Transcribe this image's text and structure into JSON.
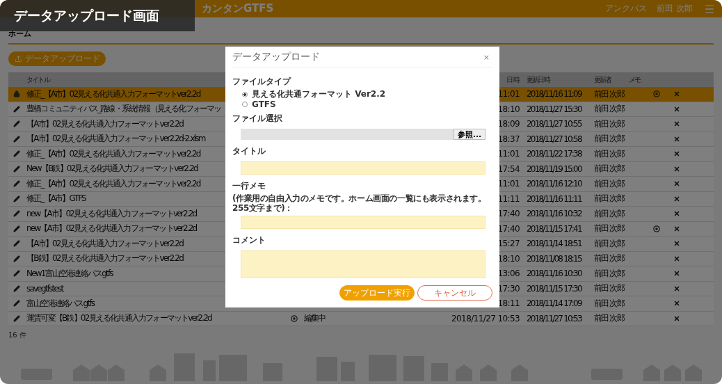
{
  "caption": "データアップロード画面",
  "app": {
    "title": "カンタンGTFS",
    "company": "アンクバス",
    "user": "前田 次郎",
    "breadcrumb": "ホーム",
    "upload_button": "データアップロード",
    "table": {
      "columns": {
        "title": "タイトル",
        "created": "日時",
        "updated": "更新日時",
        "updater": "更新者",
        "memo": "メモ"
      },
      "rows": [
        {
          "kind": "lock",
          "title": "修正_【A市】02見える化共通入力フォーマットver2.2d",
          "created": "11:01",
          "updated": "2018/11/16 11:09",
          "updater": "前田 次郎",
          "marked": true,
          "selected": true
        },
        {
          "kind": "edit",
          "title": "豊橋コミュニティバス_路線・系統情報（見える化フォーマッ",
          "created": "18:10",
          "updated": "2018/11/27 15:30",
          "updater": "前田 次郎",
          "marked": false,
          "selected": false
        },
        {
          "kind": "edit",
          "title": "【A市】02見える化共通入力フォーマットver2.2d",
          "created": "18:09",
          "updated": "2018/11/27 10:55",
          "updater": "前田 次郎",
          "marked": false,
          "selected": false
        },
        {
          "kind": "edit",
          "title": "【A市】02見える化共通入力フォーマットver2.2d-2.xlsm",
          "created": "18:37",
          "updated": "2018/11/27 10:58",
          "updater": "前田 次郎",
          "marked": false,
          "selected": false
        },
        {
          "kind": "edit",
          "title": "修正_【A市】02見える化共通入力フォーマットver2.2d",
          "created": "11:01",
          "updated": "2018/11/22 17:38",
          "updater": "前田 次郎",
          "marked": false,
          "selected": false
        },
        {
          "kind": "edit",
          "title": "New【B鉄】02見える化共通入力フォーマットver2.2d",
          "created": "17:54",
          "updated": "2018/11/19 15:00",
          "updater": "前田 次郎",
          "marked": false,
          "selected": false
        },
        {
          "kind": "edit",
          "title": "修正_【A市】02見える化共通入力フォーマットver2.2d",
          "created": "11:01",
          "updated": "2018/11/16 12:10",
          "updater": "前田 次郎",
          "marked": false,
          "selected": false
        },
        {
          "kind": "edit",
          "title": "修正_【A市】GTFS",
          "created": "11:11",
          "updated": "2018/11/16 11:11",
          "updater": "前田 次郎",
          "marked": false,
          "selected": false
        },
        {
          "kind": "edit",
          "title": "new【A市】02見える化共通入力フォーマットver2.2d",
          "created": "17:40",
          "updated": "2018/11/16 10:32",
          "updater": "前田 次郎",
          "marked": false,
          "selected": false
        },
        {
          "kind": "edit",
          "title": "new【A市】02見える化共通入力フォーマットver2.2d",
          "created": "17:40",
          "updated": "2018/11/15 17:41",
          "updater": "前田 次郎",
          "marked": true,
          "selected": false
        },
        {
          "kind": "edit",
          "title": "【A市】02見える化共通入力フォーマットver2.2d",
          "created": "15:27",
          "updated": "2018/11/14 18:51",
          "updater": "前田 次郎",
          "marked": false,
          "selected": false
        },
        {
          "kind": "edit",
          "title": "【B鉄】02見える化共通入力フォーマットver2.2d",
          "created": "18:10",
          "updated": "2018/11/08 18:15",
          "updater": "前田 次郎",
          "marked": false,
          "selected": false
        },
        {
          "kind": "edit",
          "title": "New1富山空港連絡バスgtfs",
          "created": "13:06",
          "updated": "2018/11/16 10:30",
          "updater": "前田 次郎",
          "marked": false,
          "selected": false
        },
        {
          "kind": "edit",
          "title": "savegtfstest",
          "created": "17:30",
          "updated": "2018/11/15 17:30",
          "updater": "前田 次郎",
          "marked": false,
          "selected": false
        },
        {
          "kind": "edit",
          "title": "富山空港連絡バスgtfs",
          "created": "18:11",
          "updated": "2018/11/14 17:09",
          "updater": "前田 次郎",
          "marked": false,
          "selected": false
        },
        {
          "kind": "edit",
          "title": "運賃可変【B鉄】02見える化共通入力フォーマットver2.2d",
          "status": "編集中",
          "created": "2018/11/27 10:53",
          "updated": "2018/11/27 10:53",
          "updater": "前田 次郎",
          "marked": false,
          "selected": false
        }
      ]
    },
    "count": "16 件"
  },
  "dialog": {
    "title": "データアップロード",
    "close": "×",
    "file_type": {
      "label": "ファイルタイプ",
      "options": [
        {
          "label": "見える化共通フォーマット Ver2.2",
          "selected": true
        },
        {
          "label": "GTFS",
          "selected": false
        }
      ]
    },
    "file_select": {
      "label": "ファイル選択",
      "browse": "参照..."
    },
    "title_field": {
      "label": "タイトル"
    },
    "memo_field": {
      "label": "一行メモ",
      "hint": "(作業用の自由入力のメモです。ホーム画面の一覧にも表示されます。255文字まで)："
    },
    "comment_field": {
      "label": "コメント"
    },
    "buttons": [
      {
        "label": "アップロード実行",
        "kind": "primary"
      },
      {
        "label": "キャンセル",
        "kind": "secondary"
      }
    ]
  }
}
